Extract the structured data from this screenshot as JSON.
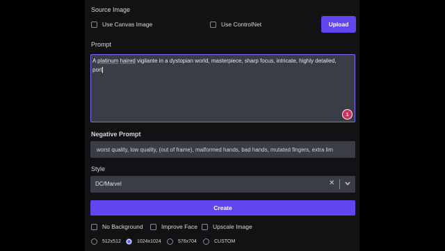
{
  "source_image": {
    "label": "Source Image",
    "use_canvas_label": "Use Canvas Image",
    "use_controlnet_label": "Use ControlNet",
    "upload_label": "Upload"
  },
  "prompt": {
    "label": "Prompt",
    "word_a": "A",
    "word_platinum": "platinum",
    "word_haired": "haired",
    "rest_line1": "vigilante in a dystopian world, masterpiece, sharp focus, intricate, highly detailed,",
    "line2": "port",
    "badge": "1"
  },
  "negative_prompt": {
    "label": "Negative Prompt",
    "value": "worst quality, low quality, (out of frame), malformed hands, bad hands, mutated fingers, extra lim"
  },
  "style": {
    "label": "Style",
    "value": "DC/Marvel"
  },
  "create_label": "Create",
  "options": {
    "no_background": "No Background",
    "improve_face": "Improve Face",
    "upscale_image": "Upscale Image"
  },
  "sizes": [
    {
      "label": "512x512",
      "selected": false
    },
    {
      "label": "1024x1024",
      "selected": true
    },
    {
      "label": "576x704",
      "selected": false
    },
    {
      "label": "CUSTOM",
      "selected": false
    }
  ],
  "colors": {
    "accent": "#6046f0",
    "input_bg": "#3a3d45",
    "badge": "#d92c5b"
  }
}
